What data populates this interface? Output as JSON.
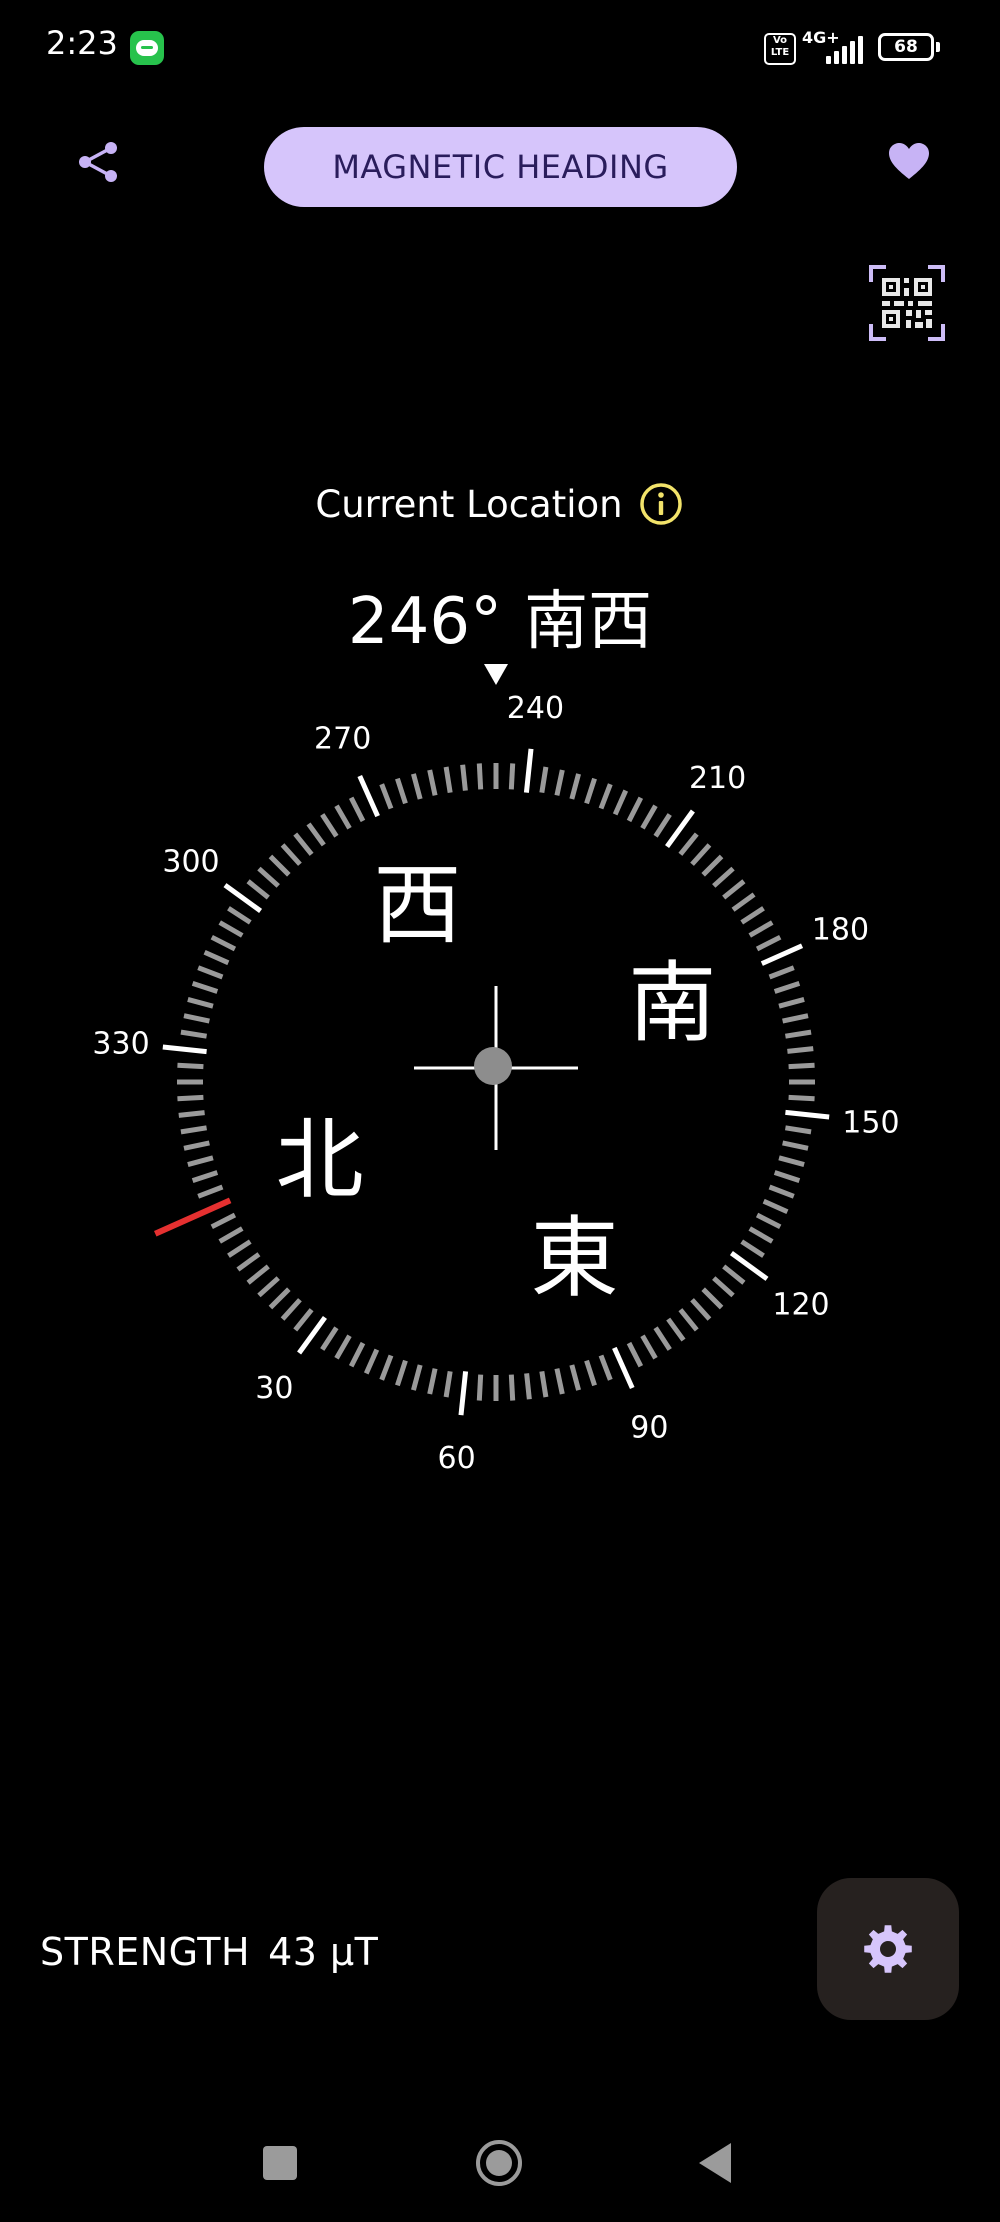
{
  "status_bar": {
    "time": "2:23",
    "network": "4G+",
    "volte": "Vo LTE",
    "battery": "68",
    "icons": [
      "line-app-icon",
      "volte-icon",
      "signal-icon",
      "battery-icon"
    ]
  },
  "header": {
    "mode_label": "MAGNETIC HEADING",
    "share_icon": "share-icon",
    "favorite_icon": "heart-icon",
    "qr_icon": "qr-code-icon"
  },
  "location": {
    "label": "Current Location",
    "info_icon": "info-icon"
  },
  "heading": {
    "degrees": "246°",
    "direction": "南西"
  },
  "compass": {
    "heading_value": 246,
    "tick_labels": [
      "240",
      "270",
      "300",
      "330",
      "30",
      "60",
      "90",
      "120",
      "150",
      "180",
      "210"
    ],
    "cardinals": {
      "west": "西",
      "south": "南",
      "east": "東",
      "north": "北"
    },
    "north_marker_color": "#e53030",
    "accent_color": "#d6c5fb"
  },
  "footer": {
    "strength_label": "STRENGTH",
    "strength_value": "43 µT",
    "settings_icon": "gear-icon"
  },
  "nav_bar": {
    "icons": [
      "recent-apps-icon",
      "home-icon",
      "back-icon"
    ]
  }
}
